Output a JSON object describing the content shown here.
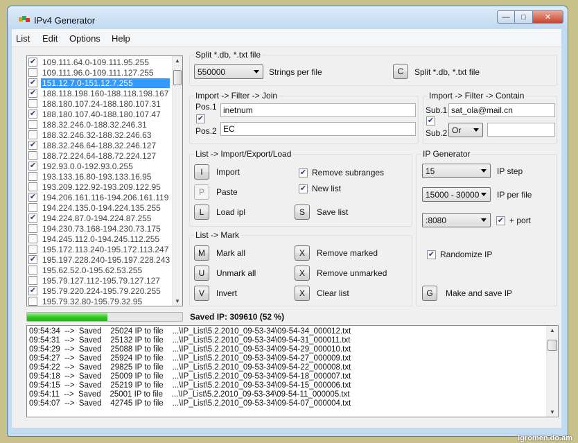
{
  "window": {
    "title": "IPv4 Generator"
  },
  "menu": [
    "List",
    "Edit",
    "Options",
    "Help"
  ],
  "ranges": [
    {
      "text": "109.111.64.0-109.111.95.255",
      "checked": true
    },
    {
      "text": "109.111.96.0-109.111.127.255",
      "checked": false
    },
    {
      "text": "151.12.7.0-151.12.7.255",
      "checked": true,
      "selected": true
    },
    {
      "text": "188.118.198.160-188.118.198.167",
      "checked": true
    },
    {
      "text": "188.180.107.24-188.180.107.31",
      "checked": false
    },
    {
      "text": "188.180.107.40-188.180.107.47",
      "checked": true
    },
    {
      "text": "188.32.246.0-188.32.246.31",
      "checked": false
    },
    {
      "text": "188.32.246.32-188.32.246.63",
      "checked": false
    },
    {
      "text": "188.32.246.64-188.32.246.127",
      "checked": true
    },
    {
      "text": "188.72.224.64-188.72.224.127",
      "checked": false
    },
    {
      "text": "192.93.0.0-192.93.0.255",
      "checked": true
    },
    {
      "text": "193.133.16.80-193.133.16.95",
      "checked": false
    },
    {
      "text": "193.209.122.92-193.209.122.95",
      "checked": false
    },
    {
      "text": "194.206.161.116-194.206.161.119",
      "checked": true
    },
    {
      "text": "194.224.135.0-194.224.135.255",
      "checked": false
    },
    {
      "text": "194.224.87.0-194.224.87.255",
      "checked": true
    },
    {
      "text": "194.230.73.168-194.230.73.175",
      "checked": false
    },
    {
      "text": "194.245.112.0-194.245.112.255",
      "checked": false
    },
    {
      "text": "195.172.113.240-195.172.113.247",
      "checked": false
    },
    {
      "text": "195.197.228.240-195.197.228.243",
      "checked": true
    },
    {
      "text": "195.62.52.0-195.62.53.255",
      "checked": false
    },
    {
      "text": "195.79.127.112-195.79.127.127",
      "checked": false
    },
    {
      "text": "195.79.220.224-195.79.220.255",
      "checked": true
    },
    {
      "text": "195.79.32.80-195.79.32.95",
      "checked": false
    }
  ],
  "split": {
    "title": "Split *.db, *.txt file",
    "combo": "550000",
    "strings_label": "Strings per file",
    "button": "C",
    "button_label": "Split *.db, *.txt file"
  },
  "join": {
    "title": "Import -> Filter -> Join",
    "pos1_label": "Pos.1",
    "pos1_value": "inetnum",
    "pos2_label": "Pos.2",
    "pos2_value": "EC",
    "checked": true
  },
  "contain": {
    "title": "Import -> Filter -> Contain",
    "sub1_label": "Sub.1",
    "sub1_value": "sat_ola@mail.cn",
    "sub2_label": "Sub.2",
    "op": "Or",
    "sub2_value": "",
    "checked": true
  },
  "import": {
    "title": "List -> Import/Export/Load",
    "import_btn": "I",
    "import_label": "Import",
    "paste_btn": "P",
    "paste_label": "Paste",
    "load_btn": "L",
    "load_label": "Load ipl",
    "save_btn": "S",
    "save_label": "Save list",
    "remove_sub_label": "Remove subranges",
    "remove_sub_checked": true,
    "new_list_label": "New list",
    "new_list_checked": true
  },
  "mark": {
    "title": "List -> Mark",
    "mark_all_btn": "M",
    "mark_all_label": "Mark all",
    "unmark_all_btn": "U",
    "unmark_all_label": "Unmark all",
    "invert_btn": "V",
    "invert_label": "Invert",
    "remove_marked_btn": "X",
    "remove_marked_label": "Remove marked",
    "remove_unmarked_btn": "X",
    "remove_unmarked_label": "Remove unmarked",
    "clear_btn": "X",
    "clear_label": "Clear list"
  },
  "generator": {
    "title": "IP Generator",
    "step": "15",
    "step_label": "IP step",
    "per_file": "15000 - 30000",
    "per_file_label": "IP per file",
    "port": ":8080",
    "port_label": "+ port",
    "port_checked": true,
    "randomize_label": "Randomize IP",
    "randomize_checked": true,
    "make_btn": "G",
    "make_label": "Make and save IP"
  },
  "status": {
    "saved": "Saved IP: 309610 (52 %)",
    "progress_fraction": 0.52
  },
  "log": [
    "09:54:34  -->  Saved    25024 IP to file    ...\\IP_List\\5.2.2010_09-53-34\\09-54-34_000012.txt",
    "09:54:31  -->  Saved    25132 IP to file    ...\\IP_List\\5.2.2010_09-53-34\\09-54-31_000011.txt",
    "09:54:29  -->  Saved    25088 IP to file    ...\\IP_List\\5.2.2010_09-53-34\\09-54-29_000010.txt",
    "09:54:27  -->  Saved    25924 IP to file    ...\\IP_List\\5.2.2010_09-53-34\\09-54-27_000009.txt",
    "09:54:22  -->  Saved    29825 IP to file    ...\\IP_List\\5.2.2010_09-53-34\\09-54-22_000008.txt",
    "09:54:18  -->  Saved    25009 IP to file    ...\\IP_List\\5.2.2010_09-53-34\\09-54-18_000007.txt",
    "09:54:15  -->  Saved    25219 IP to file    ...\\IP_List\\5.2.2010_09-53-34\\09-54-15_000006.txt",
    "09:54:11  -->  Saved    25001 IP to file    ...\\IP_List\\5.2.2010_09-53-34\\09-54-11_000005.txt",
    "09:54:07  -->  Saved    42745 IP to file    ...\\IP_List\\5.2.2010_09-53-34\\09-54-07_000004.txt"
  ],
  "watermark": "Igromen.do.am"
}
